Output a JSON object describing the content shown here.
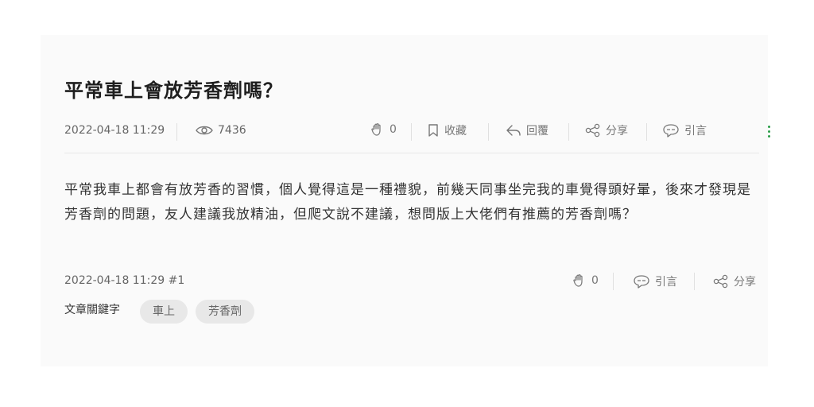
{
  "post": {
    "title": "平常車上會放芳香劑嗎？",
    "date": "2022-04-18 11:29",
    "views": "7436",
    "actions": {
      "like_count": "0",
      "bookmark_label": "收藏",
      "reply_label": "回覆",
      "share_label": "分享",
      "quote_label": "引言"
    },
    "content": "平常我車上都會有放芳香的習慣，個人覺得這是一種禮貌，前幾天同事坐完我的車覺得頭好暈，後來才發現是芳香劑的問題，友人建議我放精油，但爬文說不建議，想問版上大佬們有推薦的芳香劑嗎？"
  },
  "reply_meta": {
    "text": "2022-04-18 11:29 #1",
    "like_count": "0",
    "quote_label": "引言",
    "share_label": "分享"
  },
  "keywords": {
    "label": "文章關鍵字",
    "tags": [
      "車上",
      "芳香劑"
    ]
  },
  "icons": [
    "eye-icon",
    "clap-icon",
    "bookmark-icon",
    "reply-icon",
    "share-icon",
    "quote-icon",
    "more-icon"
  ],
  "colors": {
    "accent": "#2a9d48",
    "card_bg": "#fafafa",
    "tag_bg": "#e8e8e8"
  }
}
